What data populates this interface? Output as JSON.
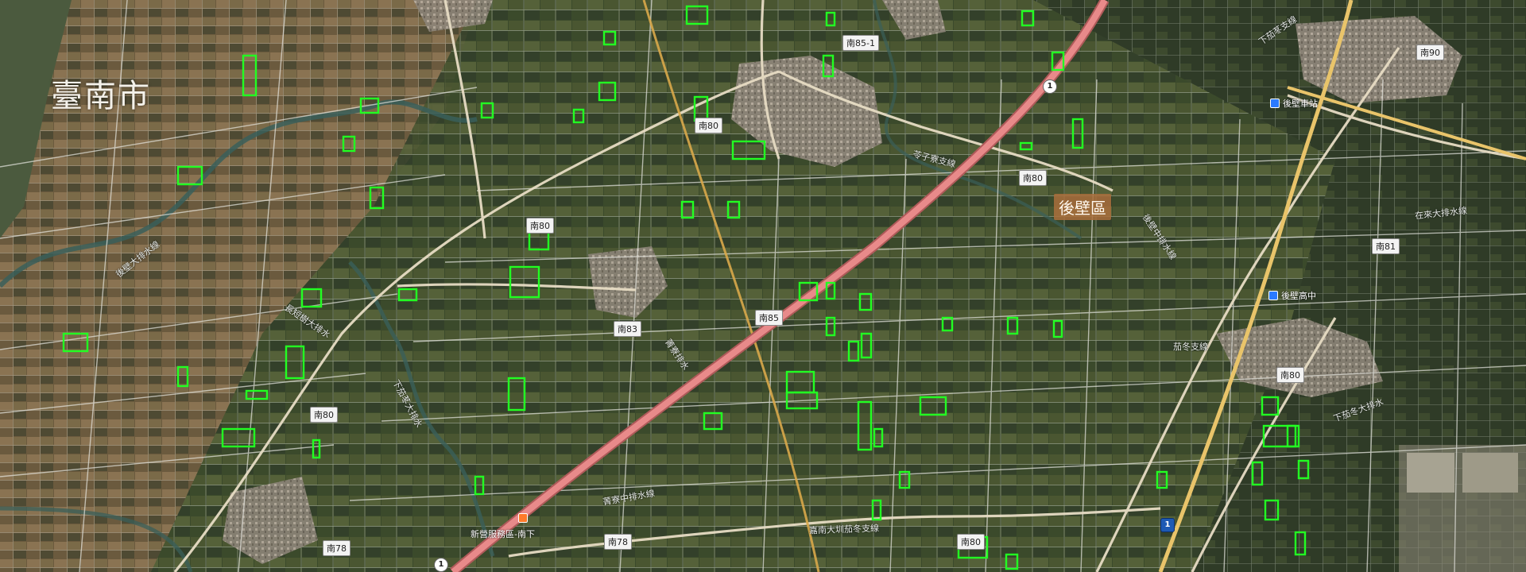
{
  "map": {
    "city_name": "臺南市",
    "district_name": "後壁區",
    "road_shields": [
      "南85-1",
      "南80",
      "南80",
      "南80",
      "南80",
      "南83",
      "南85",
      "南80",
      "南78",
      "南78",
      "南90",
      "南81",
      "南80"
    ],
    "freeway_shields": [
      "1",
      "1",
      "1"
    ],
    "canals": [
      "後壁大排水線",
      "長短樹大排水",
      "下茄苳大排水",
      "菁寮排水",
      "在來大排水線",
      "苓子寮支線",
      "茄冬支線",
      "嘉南大圳茄冬支線",
      "下茄苳支線",
      "後壁中排水線",
      "菁寮中排水線",
      "下茄冬大排水"
    ],
    "places": [
      "新營服務區-南下",
      "後壁車站",
      "後壁高中"
    ],
    "highlight_color": "#22ff22",
    "freeway_color": "#e88a8a",
    "provincial_road_color": "#e9c46a"
  }
}
